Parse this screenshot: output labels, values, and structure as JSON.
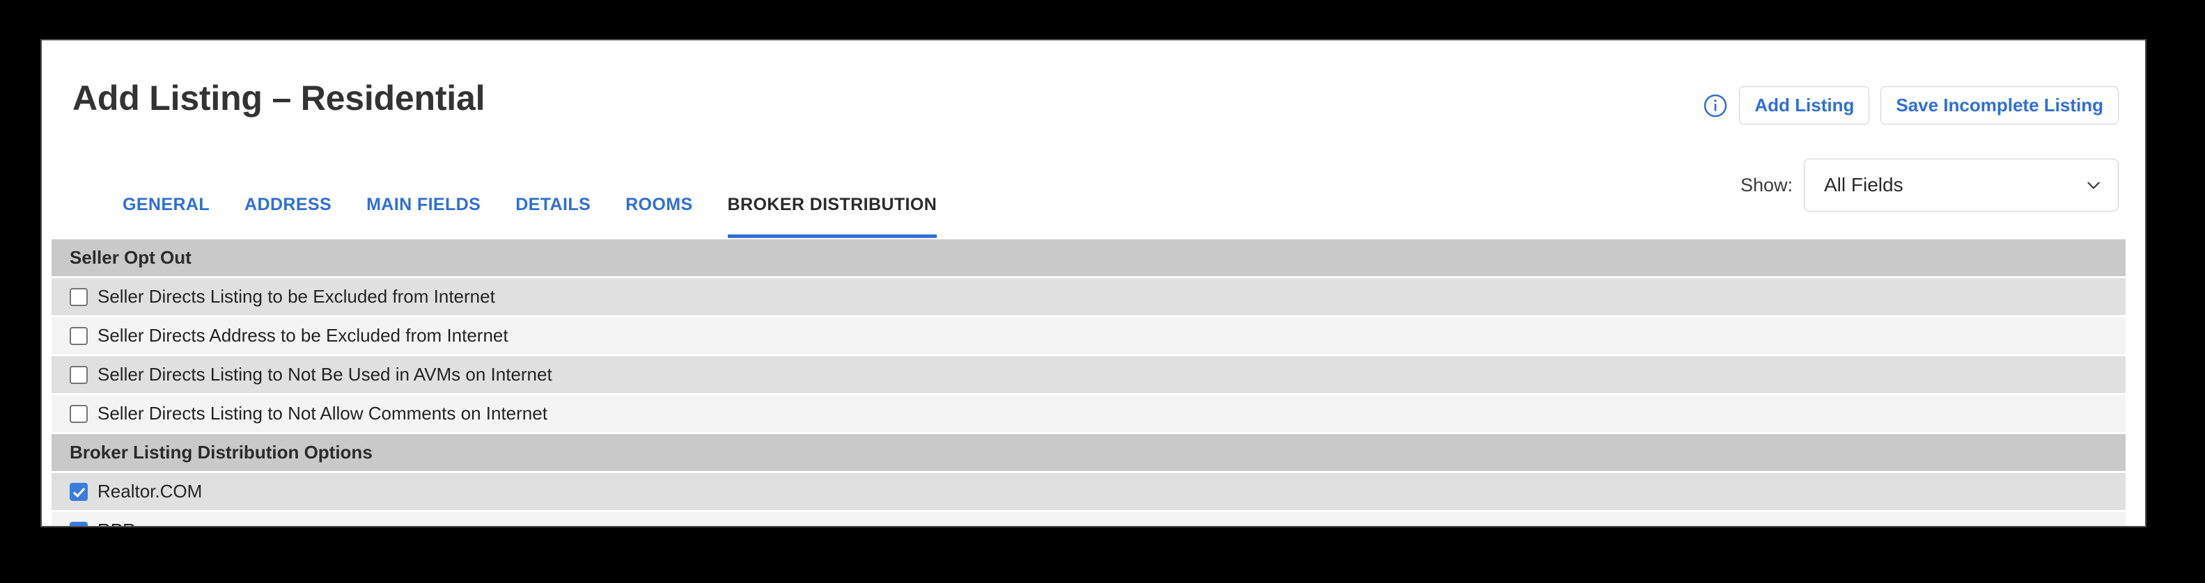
{
  "header": {
    "title": "Add Listing – Residential",
    "info_icon": "info-circle-icon",
    "buttons": [
      {
        "label": "Add Listing",
        "name": "add-listing-button"
      },
      {
        "label": "Save Incomplete Listing",
        "name": "save-incomplete-listing-button"
      }
    ]
  },
  "show": {
    "label": "Show:",
    "value": "All Fields",
    "chevron_icon": "chevron-down-icon"
  },
  "tabs": [
    {
      "label": "GENERAL",
      "active": false
    },
    {
      "label": "ADDRESS",
      "active": false
    },
    {
      "label": "MAIN FIELDS",
      "active": false
    },
    {
      "label": "DETAILS",
      "active": false
    },
    {
      "label": "ROOMS",
      "active": false
    },
    {
      "label": "BROKER DISTRIBUTION",
      "active": true
    }
  ],
  "sections": [
    {
      "title": "Seller Opt Out",
      "rows": [
        {
          "label": "Seller Directs Listing to be Excluded from Internet",
          "checked": false
        },
        {
          "label": "Seller Directs Address to be Excluded from Internet",
          "checked": false
        },
        {
          "label": "Seller Directs Listing to Not Be Used in AVMs on Internet",
          "checked": false
        },
        {
          "label": "Seller Directs Listing to Not Allow Comments on Internet",
          "checked": false
        }
      ]
    },
    {
      "title": "Broker Listing Distribution Options",
      "rows": [
        {
          "label": "Realtor.COM",
          "checked": true
        },
        {
          "label": "RPR",
          "checked": true
        }
      ]
    }
  ],
  "colors": {
    "accent_blue": "#2f6fd4",
    "checkbox_blue": "#3b7ddd",
    "section_header_bg": "#c9c9c9",
    "row_shade_a": "#e0e0e0",
    "row_shade_b": "#f4f4f4",
    "page_bg": "#000000"
  }
}
